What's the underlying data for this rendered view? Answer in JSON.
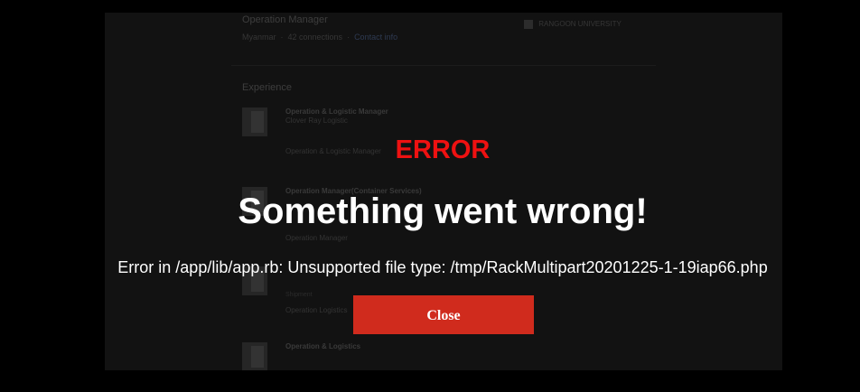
{
  "background_page": {
    "job_title": "Operation Manager",
    "location": "Myanmar",
    "connections": "42 connections",
    "contact_info": "Contact info",
    "education": "RANGOON UNIVERSITY",
    "experience_heading": "Experience",
    "items": [
      {
        "title": "Operation & Logistic Manager",
        "company": "Clover Ray Logistic",
        "dates": "",
        "location": "",
        "extra": "Operation & Logistic Manager"
      },
      {
        "title": "Operation Manager(Container Services)",
        "company": "",
        "dates": "",
        "location": "",
        "extra": "Operation Manager"
      },
      {
        "title": "",
        "company": "",
        "dates": "",
        "location": "Shipment",
        "extra": "Operation Logistics"
      },
      {
        "title": "Operation & Logistics",
        "company": "",
        "dates": "",
        "location": "",
        "extra": ""
      }
    ]
  },
  "error_dialog": {
    "label": "ERROR",
    "headline": "Something went wrong!",
    "message": "Error in /app/lib/app.rb: Unsupported file type: /tmp/RackMultipart20201225-1-19iap66.php",
    "close_label": "Close"
  },
  "colors": {
    "error_red": "#ee1111",
    "button_red": "#d02b1d",
    "text_white": "#ffffff",
    "backdrop": "#000000"
  }
}
